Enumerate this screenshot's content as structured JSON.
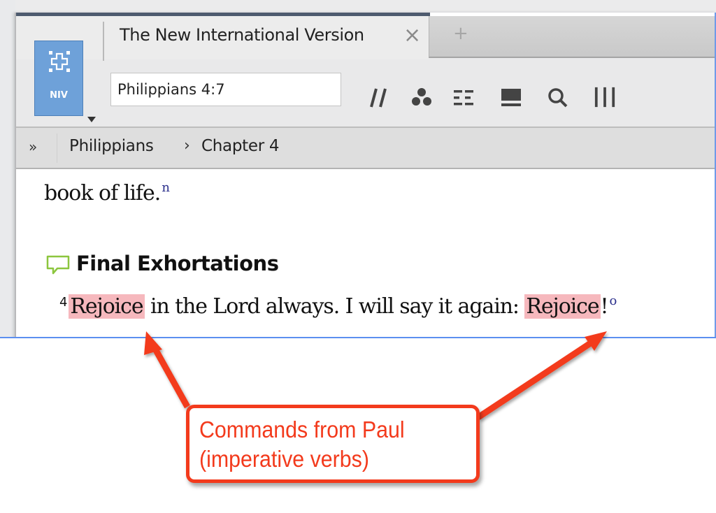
{
  "app": {
    "tab": {
      "title": "The New International Version",
      "close_icon": "close-icon",
      "new_tab_icon": "plus-icon"
    },
    "resource_button": {
      "label": "NIV",
      "icon": "bible-resource-icon",
      "accent": "#6ea1d9"
    },
    "reference_input": {
      "value": "Philippians 4:7"
    },
    "toolbar": [
      {
        "name": "parallel-resources",
        "icon": "double-slash-icon"
      },
      {
        "name": "visual-filters",
        "icon": "three-dots-icon"
      },
      {
        "name": "text-display",
        "icon": "list-columns-icon"
      },
      {
        "name": "panel-view",
        "icon": "panel-icon"
      },
      {
        "name": "search",
        "icon": "search-icon"
      },
      {
        "name": "columns",
        "icon": "columns-icon"
      }
    ],
    "breadcrumb": {
      "expand_icon": "»",
      "items": [
        "Philippians",
        "Chapter 4"
      ],
      "separator": "›"
    },
    "content": {
      "prev_text": "book of life.",
      "prev_footnote": "n",
      "section_title": "Final Exhortations",
      "section_icon": "speech-bubble-icon",
      "verse": {
        "number": "4",
        "highlight1": "Rejoice",
        "middle": " in the Lord always. I will say it again: ",
        "highlight2": "Rejoice",
        "end": "!",
        "footnote": "o"
      },
      "highlight_color": "#f6b8bd"
    }
  },
  "annotation": {
    "line1": "Commands from Paul",
    "line2": "(imperative verbs)",
    "color": "#f33a1c"
  }
}
